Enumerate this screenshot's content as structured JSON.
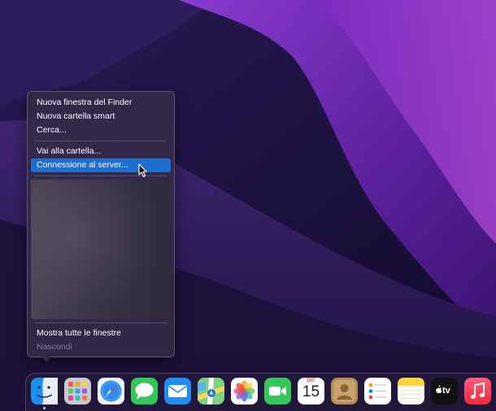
{
  "context_menu": {
    "items": [
      {
        "label": "Nuova finestra del Finder"
      },
      {
        "label": "Nuova cartella smart"
      },
      {
        "label": "Cerca..."
      }
    ],
    "items_group2": [
      {
        "label": "Vai alla cartella..."
      },
      {
        "label": "Connessione al server...",
        "highlighted": true
      }
    ],
    "items_group3": [
      {
        "label": "Mostra tutte le finestre"
      },
      {
        "label": "Nascondi",
        "disabled": true
      }
    ]
  },
  "dock": {
    "apps": [
      {
        "name": "Finder",
        "icon": "finder-icon"
      },
      {
        "name": "Launchpad",
        "icon": "launchpad-icon"
      },
      {
        "name": "Safari",
        "icon": "safari-icon"
      },
      {
        "name": "Messaggi",
        "icon": "messages-icon"
      },
      {
        "name": "Mail",
        "icon": "mail-icon"
      },
      {
        "name": "Mappe",
        "icon": "maps-icon"
      },
      {
        "name": "Foto",
        "icon": "photos-icon"
      },
      {
        "name": "FaceTime",
        "icon": "facetime-icon"
      },
      {
        "name": "Calendario",
        "icon": "calendar-icon"
      },
      {
        "name": "Contatti",
        "icon": "contacts-icon"
      },
      {
        "name": "Promemoria",
        "icon": "reminders-icon"
      },
      {
        "name": "Note",
        "icon": "notes-icon"
      },
      {
        "name": "TV",
        "icon": "tv-icon"
      },
      {
        "name": "Musica",
        "icon": "music-icon"
      }
    ],
    "calendar_month": "DIC",
    "calendar_day": "15",
    "tv_label": "tv"
  },
  "colors": {
    "highlight": "#1f6fce",
    "wallpaper_dark": "#1a0f3a",
    "wallpaper_purple": "#6a2aa8"
  }
}
